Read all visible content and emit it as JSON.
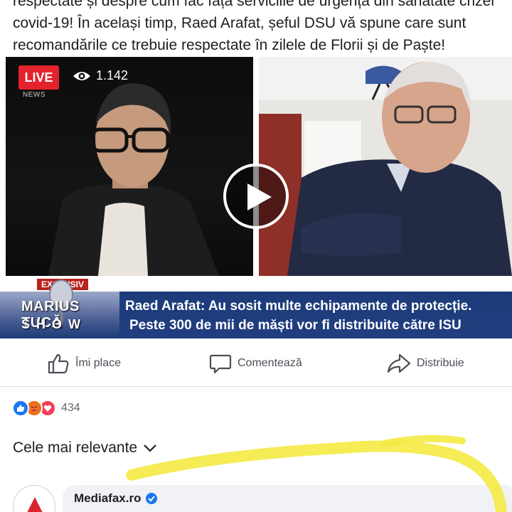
{
  "post": {
    "line1": "respectate și despre cum fac față serviciile de urgență din sănătate crizei",
    "line2": "covid-19! În același timp, Raed Arafat, șeful DSU vă spune care sunt",
    "line3": "recomandările ce trebuie respectate în zilele de Florii și de Paște!"
  },
  "video": {
    "live_label": "LIVE",
    "news_label": "NEWS",
    "viewer_count": "1.142",
    "exclusive_label": "EXCLUSIV",
    "show_logo_line1": "MARIUS TUCĂ",
    "show_logo_line2": "SHOW",
    "headline_line1": "Raed Arafat: Au sosit multe echipamente de protecție.",
    "headline_line2": "Peste 300 de mii de măști vor fi distribuite către ISU"
  },
  "actions": {
    "like_label": "Îmi place",
    "comment_label": "Comentează",
    "share_label": "Distribuie"
  },
  "reactions": {
    "count": "434",
    "types": [
      "like-icon",
      "angry-icon",
      "love-icon"
    ]
  },
  "comments": {
    "sort_label": "Cele mai relevante",
    "first_author": "Mediafax.ro"
  },
  "colors": {
    "live_red": "#e4232d",
    "facebook_blue": "#1877f2",
    "banner_blue": "#1d3b7a",
    "highlight_yellow": "#f4ea44"
  }
}
